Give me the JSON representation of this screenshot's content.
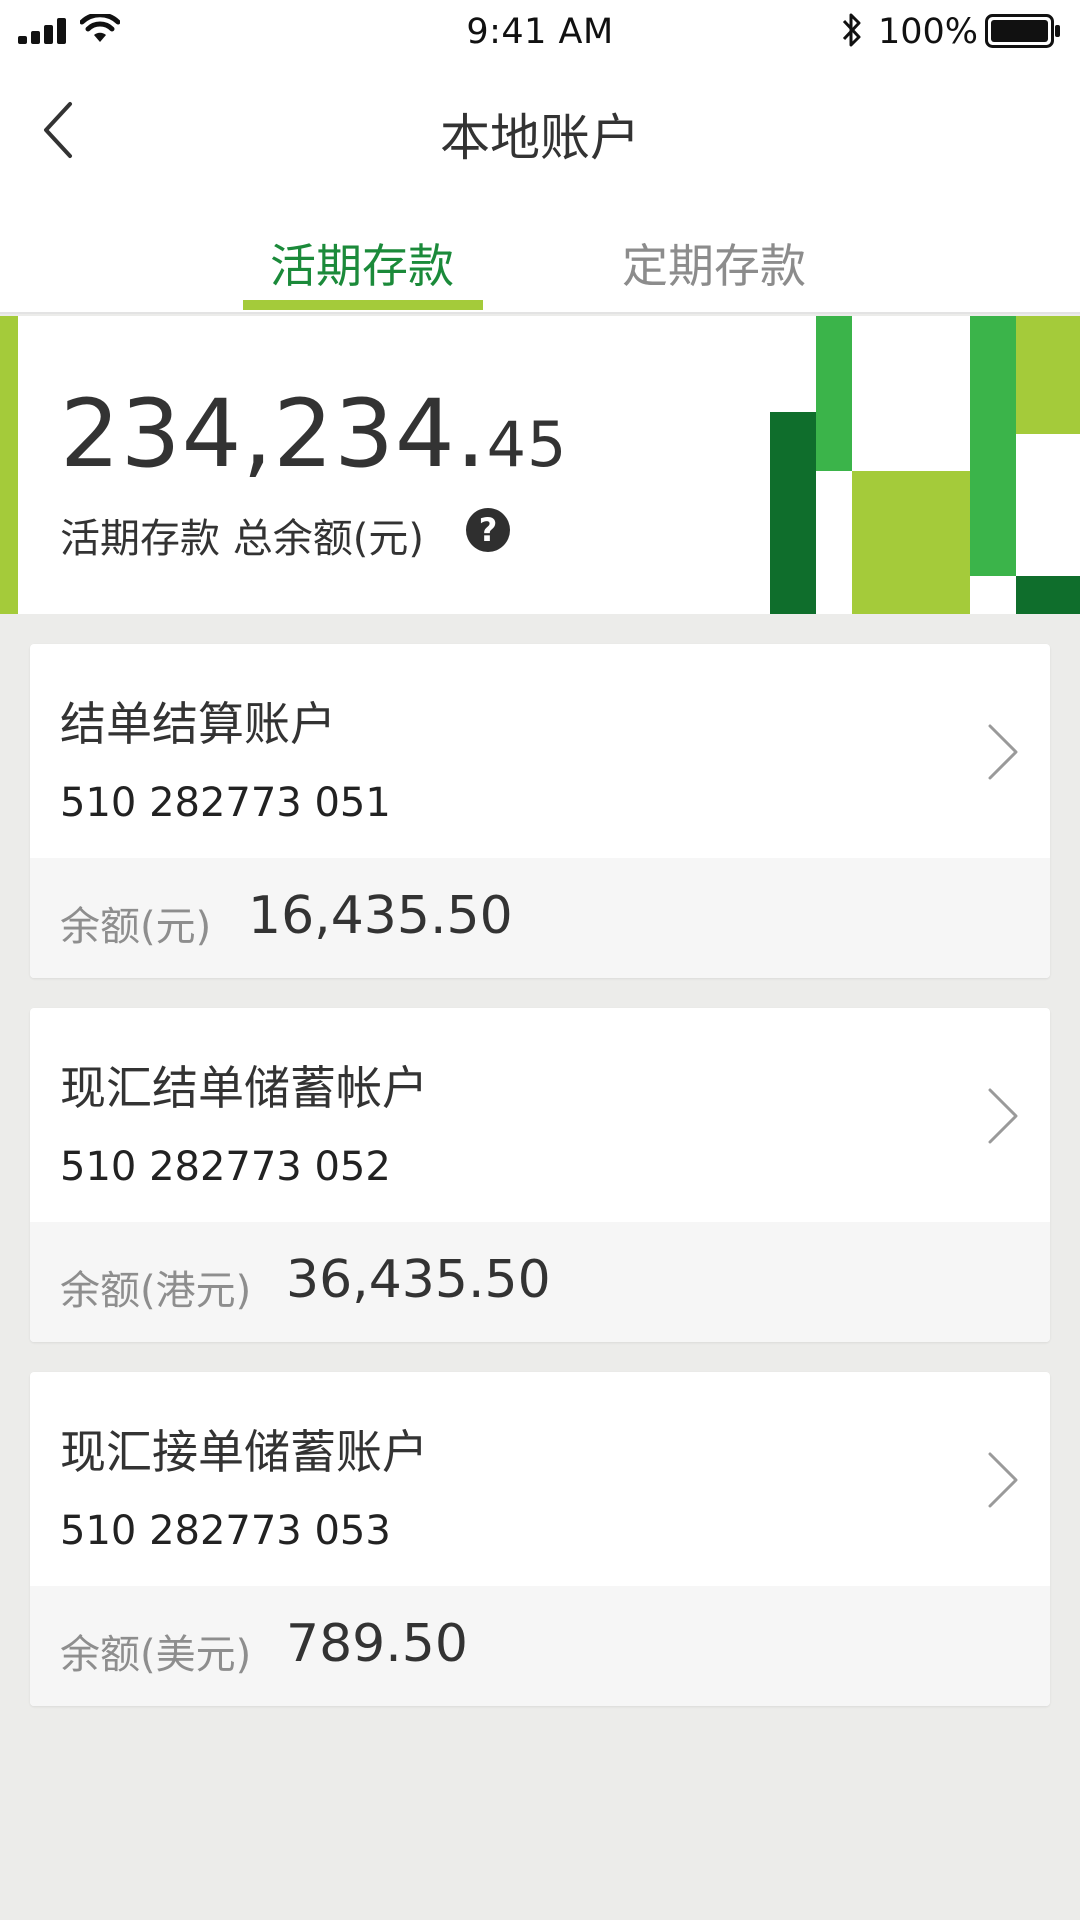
{
  "status_bar": {
    "time": "9:41 AM",
    "battery_percent": "100%",
    "icons": [
      "signal-icon",
      "wifi-icon",
      "bluetooth-icon",
      "battery-icon"
    ]
  },
  "nav": {
    "title": "本地账户",
    "back_icon": "chevron-left-icon"
  },
  "tabs": {
    "active": "活期存款",
    "inactive": "定期存款"
  },
  "summary": {
    "amount_integer": "234,234.",
    "amount_decimal": "45",
    "label": "活期存款 总余额(元)",
    "help_glyph": "?"
  },
  "accounts": [
    {
      "name": "结单结算账户",
      "number": "510 282773 051",
      "balance_label": "余额(元)",
      "balance": "16,435.50"
    },
    {
      "name": "现汇结单储蓄帐户",
      "number": "510 282773 052",
      "balance_label": "余额(港元)",
      "balance": "36,435.50"
    },
    {
      "name": "现汇接单储蓄账户",
      "number": "510 282773 053",
      "balance_label": "余额(美元)",
      "balance": "789.50"
    }
  ],
  "colors": {
    "accent_green": "#1b8a3a",
    "lime": "#a4cb3a",
    "mid_green": "#3bb44a",
    "dark_green": "#0f6e2c"
  }
}
